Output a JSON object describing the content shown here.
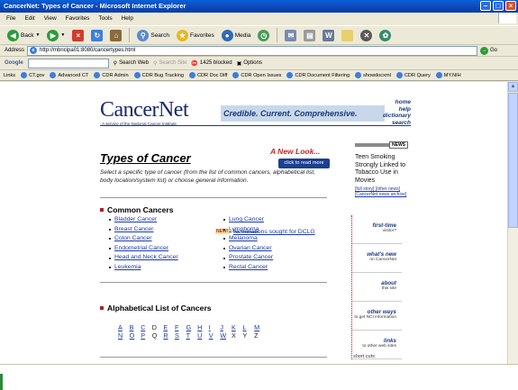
{
  "window": {
    "title": "CancerNet: Types of Cancer - Microsoft Internet Explorer"
  },
  "menu": [
    "File",
    "Edit",
    "View",
    "Favorites",
    "Tools",
    "Help"
  ],
  "toolbar": {
    "back": "Back",
    "search": "Search",
    "favorites": "Favorites",
    "media": "Media"
  },
  "address": {
    "label": "Address",
    "url": "http://mbncipa01:8080/cancertypes.html",
    "go": "Go"
  },
  "google": {
    "label": "Google",
    "search_web": "Search Web",
    "search_site": "Search Site",
    "blocked": "1425 blocked",
    "options": "Options"
  },
  "links": {
    "label": "Links",
    "items": [
      "CT.gov",
      "Advanced CT",
      "CDR Admin",
      "CDR Bug Tracking",
      "CDR Doc Diff",
      "CDR Open Issues",
      "CDR Document Filtering",
      "showdocxml",
      "CDR Query",
      "MY.NIH"
    ]
  },
  "page": {
    "logo": "CancerNet",
    "logo_sub": "A service of the National Cancer Institute",
    "tagline": "Credible. Current. Comprehensive.",
    "top_links": [
      "home",
      "help",
      "dictionary",
      "search"
    ],
    "new_look": "A New Look...",
    "click_btn": "click to read more",
    "heading": "Types of Cancer",
    "intro": "Select a specific type of cancer (from the list of common cancers, alphabetical list, body location/system list) or choose general information.",
    "common_heading": "Common Cancers",
    "new_badge": "NEW!",
    "nominations": "Nominations sought for DCLG",
    "common_left": [
      "Bladder Cancer",
      "Breast Cancer",
      "Colon Cancer",
      "Endometrial Cancer",
      "Head and Neck Cancer",
      "Leukemia"
    ],
    "common_right": [
      "Lung Cancer",
      "Lymphoma",
      "Melanoma",
      "Ovarian Cancer",
      "Prostate Cancer",
      "Rectal Cancer"
    ],
    "alpha_heading": "Alphabetical List of Cancers",
    "alpha_row1": [
      "A",
      "B",
      "C",
      "D",
      "E",
      "F",
      "G",
      "H",
      "I",
      "J",
      "K",
      "L",
      "M"
    ],
    "alpha_row2": [
      "N",
      "O",
      "P",
      "Q",
      "R",
      "S",
      "T",
      "U",
      "V",
      "W",
      "X",
      "Y",
      "Z"
    ],
    "alpha_nonlinks": [
      "D",
      "Q",
      "X",
      "Y",
      "Z"
    ]
  },
  "news": {
    "label": "NEWS",
    "text": "Teen Smoking Strongly Linked to Tobacco Use in Movies",
    "links": "[full story] [other news] [CancerNet news archive]"
  },
  "nav": [
    {
      "title": "first-time",
      "sub": "visitor?"
    },
    {
      "title": "what's new",
      "sub": "on CancerNet"
    },
    {
      "title": "about",
      "sub": "this site"
    },
    {
      "title": "other ways",
      "sub": "to get NCI information"
    },
    {
      "title": "links",
      "sub": "to other web sites"
    }
  ],
  "short_cuts": "short cuts:"
}
